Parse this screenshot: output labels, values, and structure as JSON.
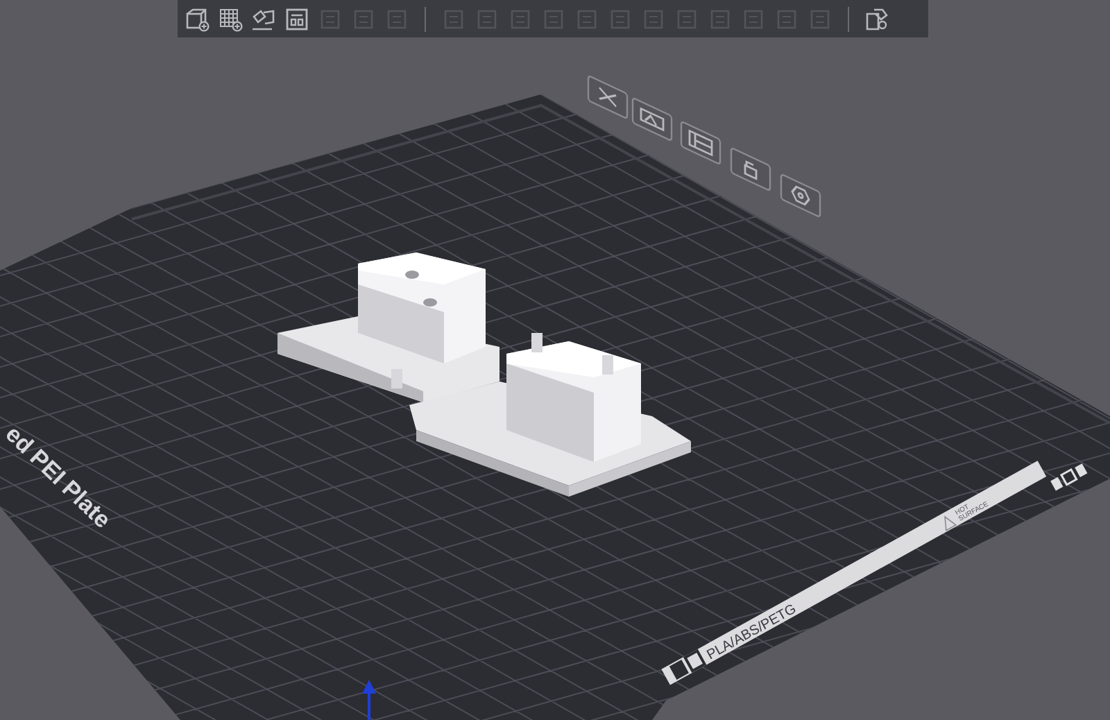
{
  "toolbar": [
    {
      "kind": "button",
      "disabled": false
    },
    {
      "kind": "button",
      "disabled": false
    },
    {
      "kind": "button",
      "disabled": false
    },
    {
      "kind": "button",
      "disabled": false
    },
    {
      "kind": "button",
      "disabled": true
    },
    {
      "kind": "button",
      "disabled": true
    },
    {
      "kind": "button",
      "disabled": true
    },
    {
      "kind": "separator"
    },
    {
      "kind": "button",
      "disabled": true
    },
    {
      "kind": "button",
      "disabled": true
    },
    {
      "kind": "button",
      "disabled": true
    },
    {
      "kind": "button",
      "disabled": true
    },
    {
      "kind": "button",
      "disabled": true
    },
    {
      "kind": "button",
      "disabled": true
    },
    {
      "kind": "button",
      "disabled": true
    },
    {
      "kind": "button",
      "disabled": true
    },
    {
      "kind": "button",
      "disabled": true
    },
    {
      "kind": "button",
      "disabled": true
    },
    {
      "kind": "button",
      "disabled": true
    },
    {
      "kind": "button",
      "disabled": true
    },
    {
      "kind": "separator"
    },
    {
      "kind": "button",
      "disabled": false
    }
  ],
  "plate": {
    "name": "ed PEI Plate",
    "filament": "PLA/ABS/PETG",
    "warning": [
      "HOT",
      "SURFACE"
    ]
  }
}
